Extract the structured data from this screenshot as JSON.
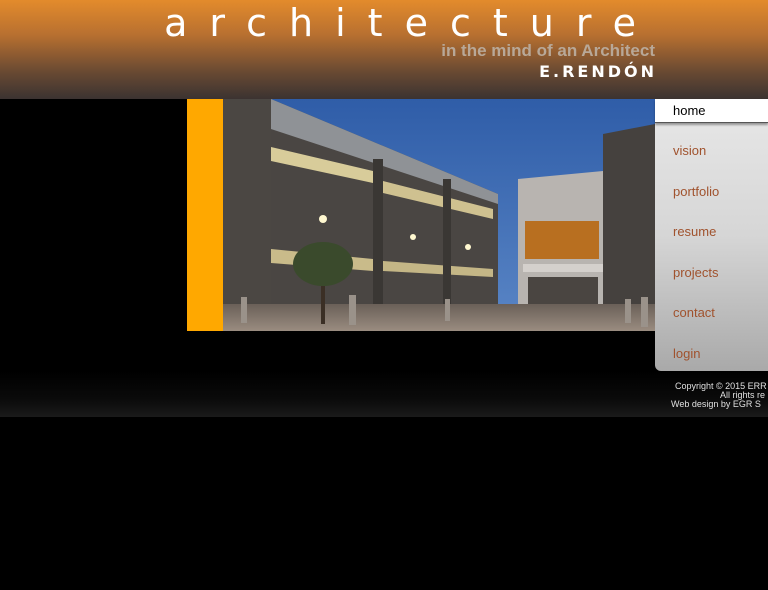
{
  "header": {
    "title": "architecture",
    "tagline": "in the mind of an Architect",
    "name": "E.RENDÓN"
  },
  "hero": {
    "accent_color": "#ffa800",
    "image": "building-exterior-at-dusk"
  },
  "nav": {
    "items": [
      {
        "label": "home",
        "active": true
      },
      {
        "label": "vision",
        "active": false
      },
      {
        "label": "portfolio",
        "active": false
      },
      {
        "label": "resume",
        "active": false
      },
      {
        "label": "projects",
        "active": false
      },
      {
        "label": "contact",
        "active": false
      },
      {
        "label": "login",
        "active": false
      }
    ],
    "link_color": "#a0522d"
  },
  "footer": {
    "copyright": "Copyright © 2015 ERR",
    "rights": "All rights re",
    "credit": "Web design by EGR S"
  }
}
